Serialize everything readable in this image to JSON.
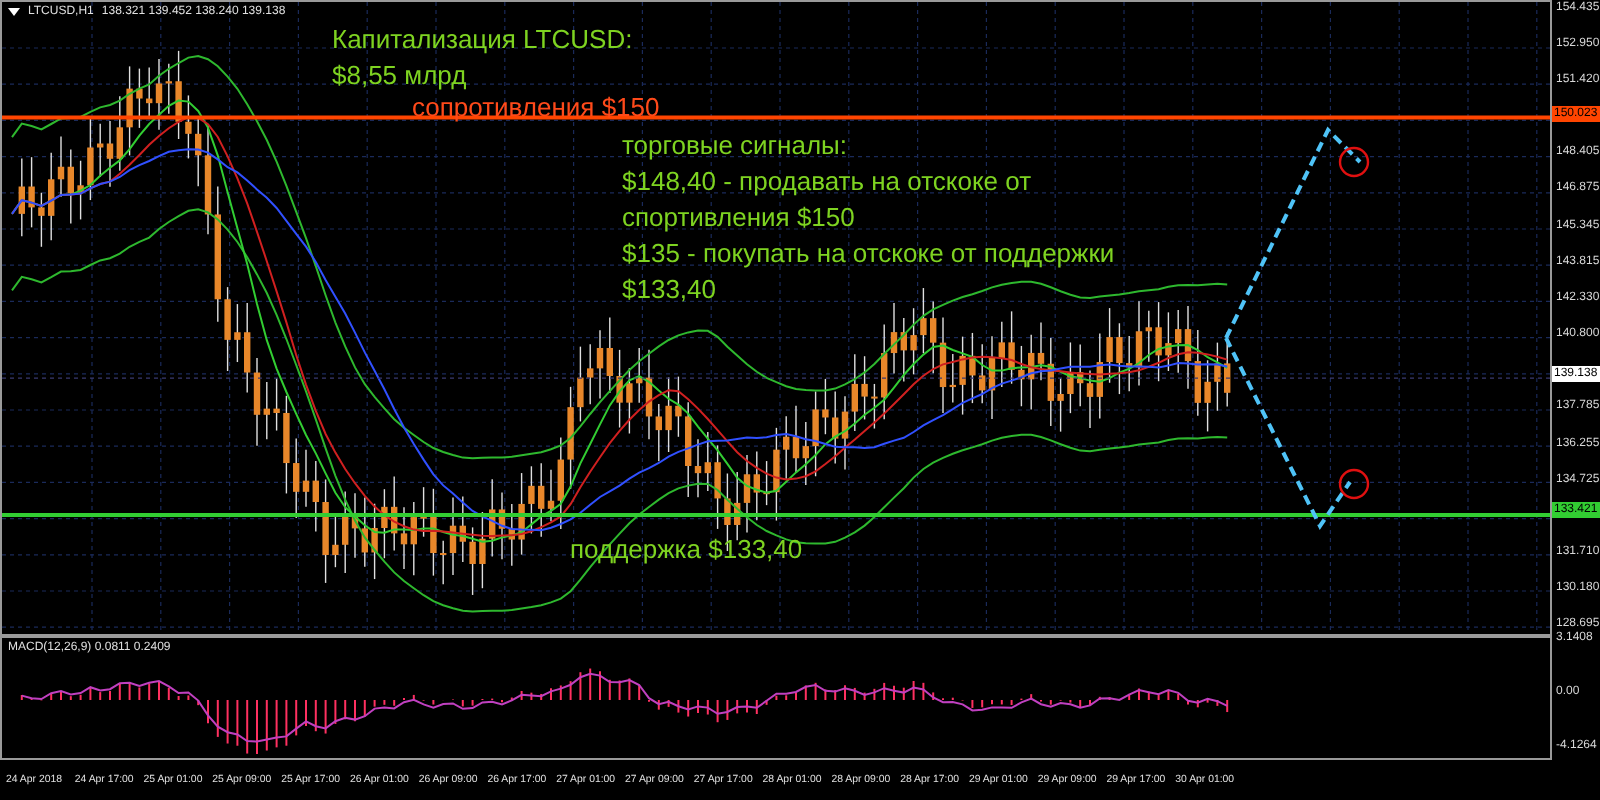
{
  "chart_header": {
    "symbol": "LTCUSD,H1",
    "ohlc": "138.321 139.452 138.240 139.138"
  },
  "annotations": [
    {
      "kind": "info",
      "lines": [
        "Капитализация LTCUSD:",
        "$8,55 млрд"
      ]
    },
    {
      "kind": "resistance",
      "lines": [
        "сопротивления $150"
      ]
    },
    {
      "kind": "info",
      "lines": [
        "торговые сигналы:",
        "$148,40 - продавать на отскоке от",
        "спортивления $150",
        "$135 - покупать на отскоке от поддержки",
        "$133,40"
      ]
    },
    {
      "kind": "support",
      "lines": [
        "поддержка $133,40"
      ]
    }
  ],
  "levels": [
    {
      "price": "150.023",
      "color": "#ff4500"
    },
    {
      "price": "133.421",
      "color": "#32cd32"
    }
  ],
  "current_price": "139.138",
  "price_axis": [
    "154.435",
    "152.950",
    "151.420",
    "148.405",
    "146.875",
    "145.345",
    "143.815",
    "142.330",
    "140.800",
    "137.785",
    "136.255",
    "134.725",
    "131.710",
    "130.180",
    "128.695"
  ],
  "macd": {
    "label": "MACD(12,26,9) 0.0811 0.2409",
    "axis": [
      "3.1408",
      "0.00",
      "-4.1264"
    ]
  },
  "time_axis": [
    "24 Apr 2018",
    "24 Apr 17:00",
    "25 Apr 01:00",
    "25 Apr 09:00",
    "25 Apr 17:00",
    "26 Apr 01:00",
    "26 Apr 09:00",
    "26 Apr 17:00",
    "27 Apr 01:00",
    "27 Apr 09:00",
    "27 Apr 17:00",
    "28 Apr 01:00",
    "28 Apr 09:00",
    "28 Apr 17:00",
    "29 Apr 01:00",
    "29 Apr 09:00",
    "29 Apr 17:00",
    "30 Apr 01:00"
  ]
}
